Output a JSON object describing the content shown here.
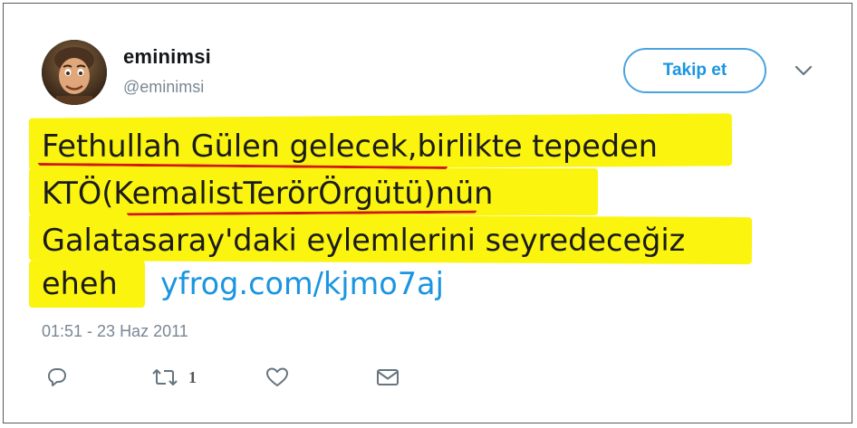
{
  "user": {
    "display_name": "eminimsi",
    "handle": "@eminimsi",
    "avatar_icon": "profile-avatar"
  },
  "header": {
    "follow_label": "Takip et",
    "more_icon": "chevron-down-icon"
  },
  "tweet": {
    "line1": "Fethullah Gülen gelecek,birlikte tepeden",
    "line2": "KTÖ(KemalistTerörÖrgütü)nün",
    "line3": "Galatasaray'daki eylemlerini seyredeceğiz",
    "line4_text": "eheh",
    "link": "yfrog.com/kjmo7aj",
    "highlight_color": "#fbf40e",
    "underline_color": "#d0181a",
    "link_color": "#1b95e0"
  },
  "timestamp": "01:51 - 23 Haz 2011",
  "actions": {
    "reply_icon": "reply-icon",
    "retweet_icon": "retweet-icon",
    "retweet_count": "1",
    "like_icon": "heart-icon",
    "dm_icon": "envelope-icon"
  }
}
